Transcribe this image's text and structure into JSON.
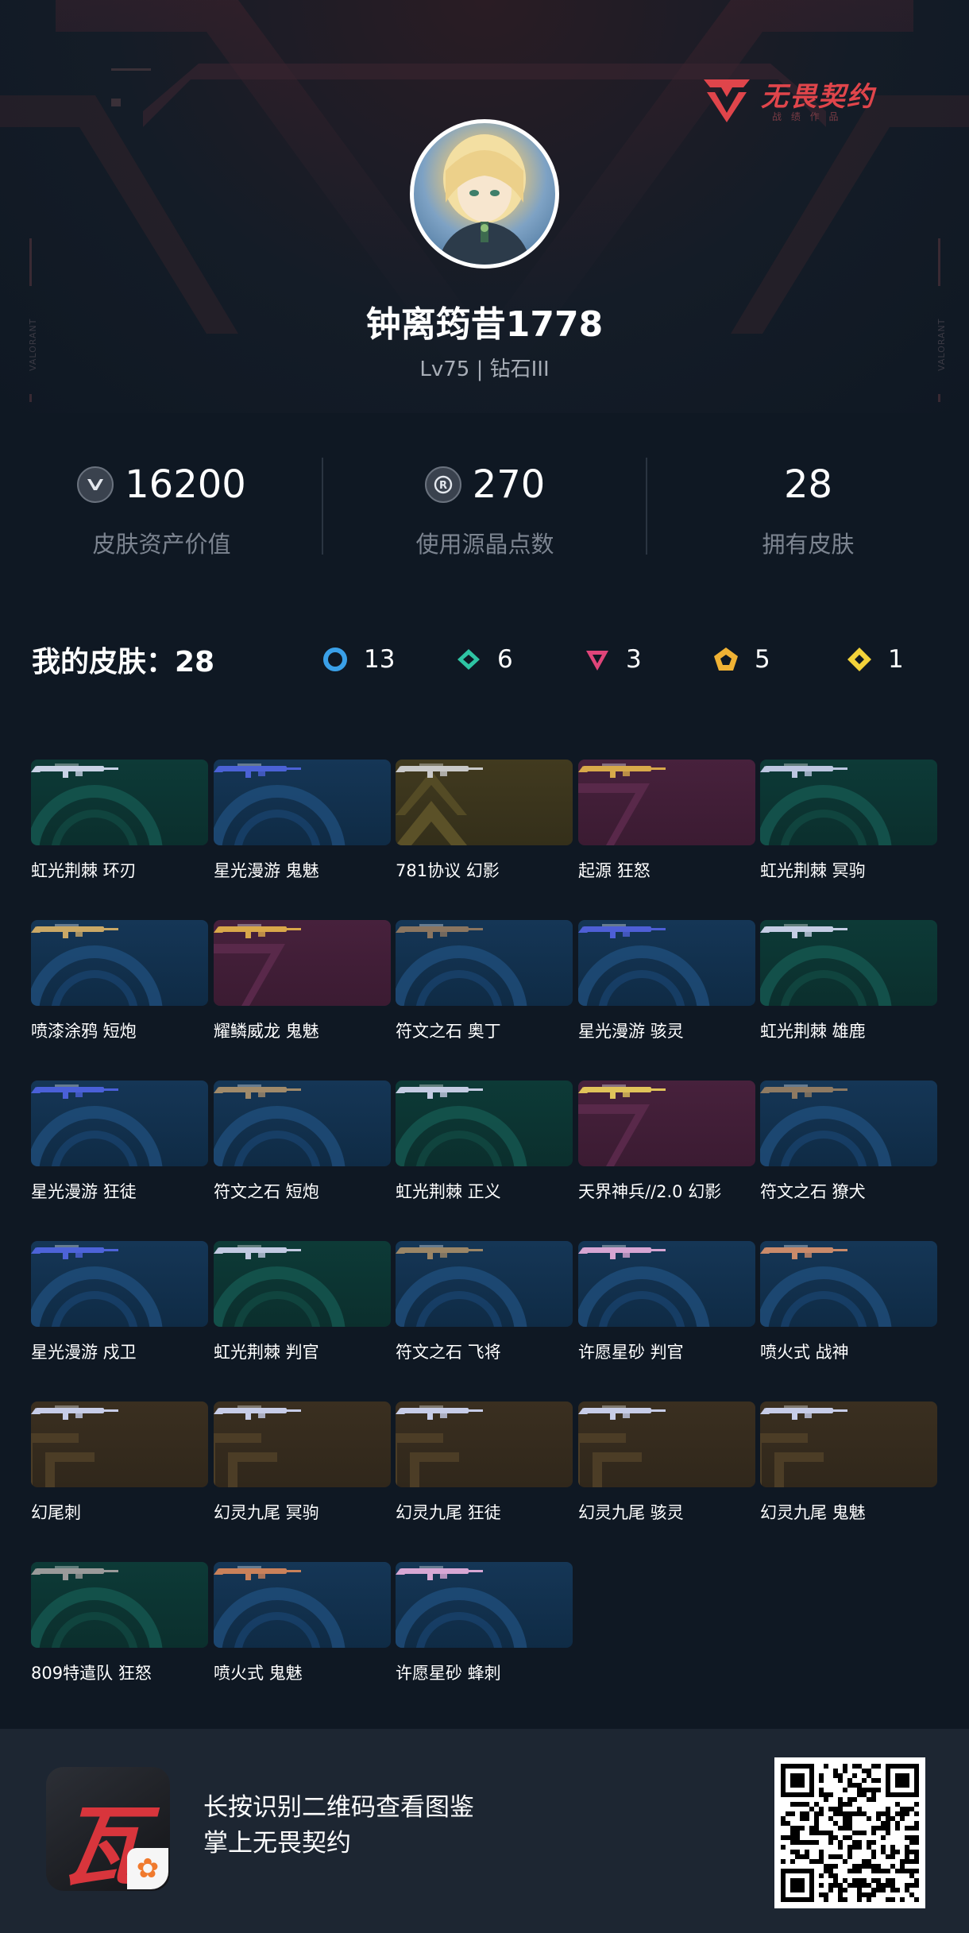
{
  "brand": {
    "name": "无畏契约",
    "sub": "战 绩 作 品",
    "side_mark": "VALORANT"
  },
  "profile": {
    "username": "钟离筠昔1778",
    "level": "Lv75 | 钻石III"
  },
  "stats": [
    {
      "icon": "valorant-points-icon",
      "value": "16200",
      "label": "皮肤资产价值"
    },
    {
      "icon": "radianite-icon",
      "value": "270",
      "label": "使用源晶点数"
    },
    {
      "icon": "",
      "value": "28",
      "label": "拥有皮肤"
    }
  ],
  "skins_header": {
    "title": "我的皮肤：28",
    "rarities": [
      {
        "tier": "select",
        "color": "#3aa0e8",
        "count": "13"
      },
      {
        "tier": "deluxe",
        "color": "#2ec4a3",
        "count": "6"
      },
      {
        "tier": "premium",
        "color": "#e0457a",
        "count": "3"
      },
      {
        "tier": "ultra",
        "color": "#f0b234",
        "count": "5"
      },
      {
        "tier": "exclusive",
        "color": "#f2d23a",
        "count": "1"
      }
    ]
  },
  "skins": [
    {
      "name": "虹光荆棘 环刃",
      "tier": "green",
      "weapon_color": "#c9d2e6"
    },
    {
      "name": "星光漫游 鬼魅",
      "tier": "blue",
      "weapon_color": "#4b62d6"
    },
    {
      "name": "781协议 幻影",
      "tier": "gold",
      "weapon_color": "#c9c9c9"
    },
    {
      "name": "起源 狂怒",
      "tier": "pink",
      "weapon_color": "#d7a94a"
    },
    {
      "name": "虹光荆棘 冥驹",
      "tier": "green",
      "weapon_color": "#bcc6e0"
    },
    {
      "name": "喷漆涂鸦 短炮",
      "tier": "blue",
      "weapon_color": "#c9a866"
    },
    {
      "name": "耀鳞威龙 鬼魅",
      "tier": "pink",
      "weapon_color": "#d9a84a"
    },
    {
      "name": "符文之石 奥丁",
      "tier": "blue",
      "weapon_color": "#8a7560"
    },
    {
      "name": "星光漫游 骇灵",
      "tier": "blue",
      "weapon_color": "#4e5fd6"
    },
    {
      "name": "虹光荆棘 雄鹿",
      "tier": "green",
      "weapon_color": "#c4cde4"
    },
    {
      "name": "星光漫游 狂徒",
      "tier": "blue",
      "weapon_color": "#4a60d8"
    },
    {
      "name": "符文之石 短炮",
      "tier": "blue",
      "weapon_color": "#a08a6a"
    },
    {
      "name": "虹光荆棘 正义",
      "tier": "green",
      "weapon_color": "#c3cbe2"
    },
    {
      "name": "天界神兵//2.0 幻影",
      "tier": "pink",
      "weapon_color": "#e0c35a"
    },
    {
      "name": "符文之石 獠犬",
      "tier": "blue",
      "weapon_color": "#8e7a62"
    },
    {
      "name": "星光漫游 戍卫",
      "tier": "blue",
      "weapon_color": "#4d63d8"
    },
    {
      "name": "虹光荆棘 判官",
      "tier": "green",
      "weapon_color": "#c1c9e1"
    },
    {
      "name": "符文之石 飞将",
      "tier": "blue",
      "weapon_color": "#9a8566"
    },
    {
      "name": "许愿星砂 判官",
      "tier": "blue",
      "weapon_color": "#d6a5d2"
    },
    {
      "name": "喷火式 战神",
      "tier": "blue",
      "weapon_color": "#c98a6a"
    },
    {
      "name": "幻尾刺",
      "tier": "brown",
      "weapon_color": "#c7cde8"
    },
    {
      "name": "幻灵九尾 冥驹",
      "tier": "brown",
      "weapon_color": "#c7cde8"
    },
    {
      "name": "幻灵九尾 狂徒",
      "tier": "brown",
      "weapon_color": "#c7cde8"
    },
    {
      "name": "幻灵九尾 骇灵",
      "tier": "brown",
      "weapon_color": "#c7cde8"
    },
    {
      "name": "幻灵九尾 鬼魅",
      "tier": "brown",
      "weapon_color": "#c7cde8"
    },
    {
      "name": "809特遣队 狂怒",
      "tier": "green",
      "weapon_color": "#9a9a9a"
    },
    {
      "name": "喷火式 鬼魅",
      "tier": "blue",
      "weapon_color": "#c9815a"
    },
    {
      "name": "许愿星砂 蜂刺",
      "tier": "blue",
      "weapon_color": "#d7a7d4"
    }
  ],
  "footer": {
    "line1": "长按识别二维码查看图鉴",
    "line2": "掌上无畏契约",
    "app_glyph": "瓦"
  }
}
